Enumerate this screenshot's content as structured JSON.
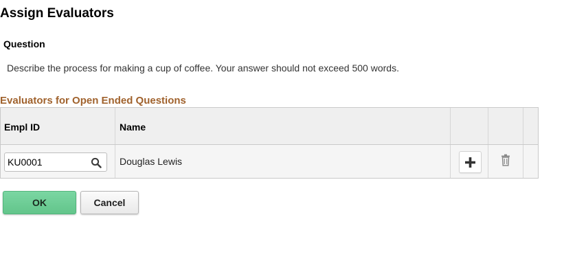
{
  "page": {
    "title": "Assign Evaluators",
    "question_label": "Question",
    "question_text": "Describe the process for making a cup of coffee. Your answer should not exceed 500 words.",
    "section_title": "Evaluators for Open Ended Questions"
  },
  "grid": {
    "columns": [
      "Empl ID",
      "Name"
    ],
    "rows": [
      {
        "empl_id": "KU0001",
        "name": "Douglas Lewis"
      }
    ]
  },
  "buttons": {
    "ok_label": "OK",
    "cancel_label": "Cancel"
  },
  "icons": {
    "lookup": "search-icon",
    "add": "plus-icon",
    "delete": "trash-icon"
  },
  "colors": {
    "section_title": "#a0622d",
    "ok_button": "#6fcf97"
  }
}
